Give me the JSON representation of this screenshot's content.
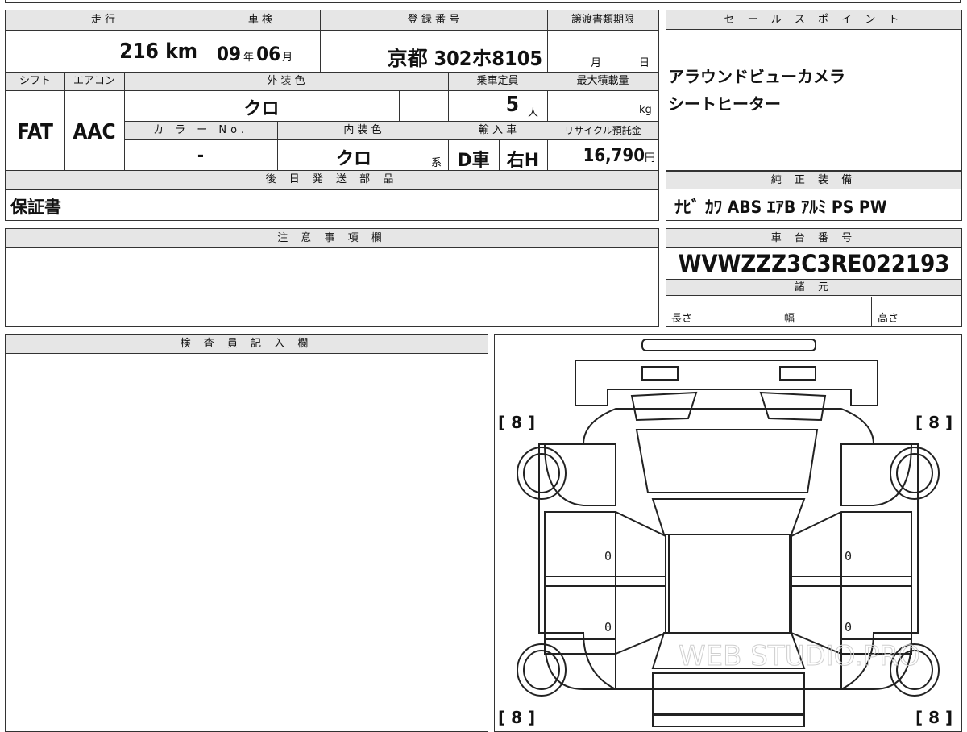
{
  "info": {
    "labels": {
      "mileage": "走 行",
      "inspection": "車 検",
      "registration": "登 録 番 号",
      "transfer_deadline": "譲渡書類期限",
      "shift": "シフト",
      "aircon": "エアコン",
      "exterior_color": "外 装 色",
      "capacity": "乗車定員",
      "max_load": "最大積載量",
      "color_no": "カ ラ ー No.",
      "interior_color": "内 装 色",
      "import": "輸 入 車",
      "recycle": "リサイクル預託金"
    },
    "mileage_value": "216",
    "mileage_unit": "km",
    "inspection_year": "09",
    "year_unit": "年",
    "inspection_month": "06",
    "month_unit": "月",
    "registration_value": "京都 302ホ8105",
    "deadline_month_unit": "月",
    "deadline_day_unit": "日",
    "shift_value": "FAT",
    "aircon_value": "AAC",
    "exterior_color_value": "クロ",
    "capacity_value": "5",
    "capacity_unit": "人",
    "max_load_unit": "kg",
    "color_no_value": "-",
    "interior_color_value": "クロ",
    "interior_suffix": "系",
    "import_type": "D車",
    "steering": "右H",
    "recycle_value": "16,790",
    "recycle_unit": "円"
  },
  "sales_points": {
    "label": "セ ー ル ス ポ イ ン ト",
    "items": [
      "アラウンドビューカメラ",
      "シートヒーター"
    ]
  },
  "parts": {
    "label": "後 日 発 送 部 品",
    "value": "保証書"
  },
  "equipment": {
    "label": "純 正 装 備",
    "value": "ﾅﾋﾞ ｶﾜ ABS ｴｱB ｱﾙﾐ PS PW"
  },
  "notes": {
    "label": "注 意 事 項 欄"
  },
  "chassis": {
    "label": "車 台 番 号",
    "value": "WVWZZZ3C3RE022193"
  },
  "specs": {
    "label": "諸 元",
    "length": "長さ",
    "width": "幅",
    "height": "高さ"
  },
  "inspector": {
    "label": "検 査 員 記 入 欄"
  },
  "diagram": {
    "tire_fl": "[ 8 ]",
    "tire_fr": "[ 8 ]",
    "tire_rl": "[ 8 ]",
    "tire_rr": "[ 8 ]",
    "door_fl": "0",
    "door_fr": "0",
    "door_rl": "0",
    "door_rr": "0",
    "watermark": "WEB STUDIO.PRO"
  }
}
